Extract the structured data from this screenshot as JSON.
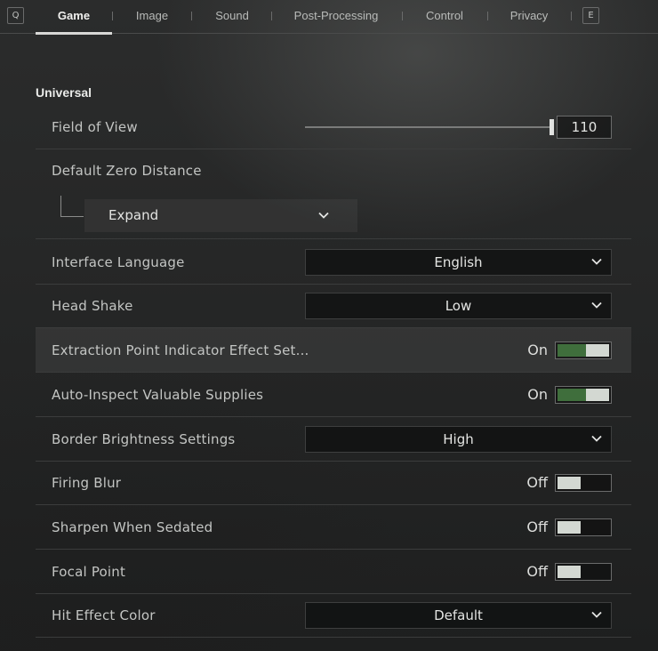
{
  "topbar": {
    "left_key": "Q",
    "right_key": "E",
    "tabs": [
      {
        "label": "Game",
        "active": true
      },
      {
        "label": "Image",
        "active": false
      },
      {
        "label": "Sound",
        "active": false
      },
      {
        "label": "Post-Processing",
        "active": false
      },
      {
        "label": "Control",
        "active": false
      },
      {
        "label": "Privacy",
        "active": false
      }
    ]
  },
  "section": {
    "title": "Universal"
  },
  "settings": {
    "fov": {
      "label": "Field of View",
      "value": "110",
      "slider_fraction": 1.0
    },
    "zero_distance": {
      "label": "Default Zero Distance",
      "expand_label": "Expand"
    },
    "interface_language": {
      "label": "Interface Language",
      "value": "English"
    },
    "head_shake": {
      "label": "Head Shake",
      "value": "Low"
    },
    "extraction_indicator": {
      "label": "Extraction Point Indicator Effect Set...",
      "state": "On",
      "on": true
    },
    "auto_inspect": {
      "label": "Auto-Inspect Valuable Supplies",
      "state": "On",
      "on": true
    },
    "border_brightness": {
      "label": "Border Brightness Settings",
      "value": "High"
    },
    "firing_blur": {
      "label": "Firing Blur",
      "state": "Off",
      "on": false
    },
    "sharpen_sedated": {
      "label": "Sharpen When Sedated",
      "state": "Off",
      "on": false
    },
    "focal_point": {
      "label": "Focal Point",
      "state": "Off",
      "on": false
    },
    "hit_effect_color": {
      "label": "Hit Effect Color",
      "value": "Default"
    }
  },
  "colors": {
    "toggle_on": "#3f6e3c",
    "toggle_knob": "#d3d8d2"
  }
}
